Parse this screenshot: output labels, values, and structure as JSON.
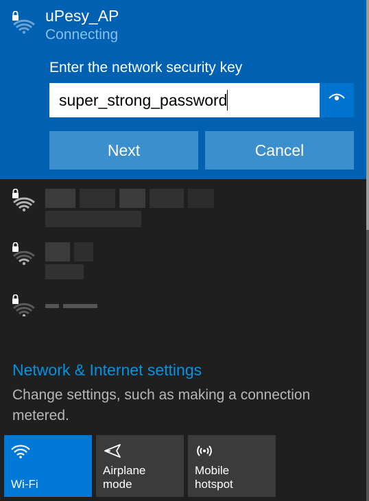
{
  "expanded": {
    "ssid": "uPesy_AP",
    "status": "Connecting",
    "prompt": "Enter the network security key",
    "password_value": "super_strong_password",
    "next_label": "Next",
    "cancel_label": "Cancel"
  },
  "other_networks": [
    {
      "secured": true
    },
    {
      "secured": true
    },
    {
      "secured": true
    }
  ],
  "settings": {
    "title": "Network & Internet settings",
    "description": "Change settings, such as making a connection metered."
  },
  "tiles": {
    "wifi": "Wi-Fi",
    "airplane": "Airplane mode",
    "hotspot": "Mobile hotspot"
  }
}
